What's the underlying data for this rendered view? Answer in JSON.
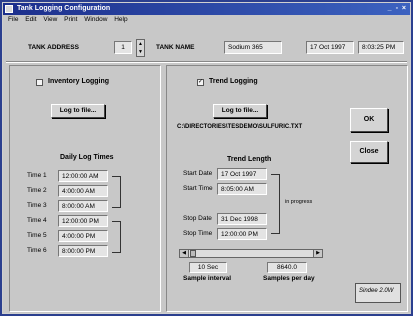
{
  "window": {
    "title": "Tank Logging Configuration",
    "controls": "_ ▫ ×"
  },
  "menu": [
    "File",
    "Edit",
    "View",
    "Print",
    "Window",
    "Help"
  ],
  "toolbar": {
    "tank_address_label": "TANK ADDRESS",
    "tank_address_value": "1",
    "tank_name_label": "TANK NAME",
    "tank_name_value": "Sodium 365",
    "date": "17 Oct 1997",
    "time": "8:03:25 PM"
  },
  "inventory": {
    "checkbox_label": "Inventory Logging",
    "checked": false,
    "log_button": "Log to file...",
    "daily_header": "Daily Log Times",
    "times": [
      {
        "label": "Time 1",
        "value": "12:00:00 AM"
      },
      {
        "label": "Time 2",
        "value": "4:00:00 AM"
      },
      {
        "label": "Time 3",
        "value": "8:00:00 AM"
      },
      {
        "label": "Time 4",
        "value": "12:00:00 PM"
      },
      {
        "label": "Time 5",
        "value": "4:00:00 PM"
      },
      {
        "label": "Time 6",
        "value": "8:00:00 PM"
      }
    ]
  },
  "trend": {
    "checkbox_label": "Trend Logging",
    "checked": true,
    "log_button": "Log to file...",
    "file_path": "C:\\DIRECTORIES\\TESDEMO\\SULFURIC.TXT",
    "length_header": "Trend Length",
    "start_date_label": "Start Date",
    "start_date": "17 Oct 1997",
    "start_time_label": "Start Time",
    "start_time": "8:05:00 AM",
    "stop_date_label": "Stop Date",
    "stop_date": "31 Dec 1998",
    "stop_time_label": "Stop Time",
    "stop_time": "12:00:00 PM",
    "status": "in progress",
    "interval_value": "10 Sec",
    "interval_label": "Sample interval",
    "samples_value": "8640.0",
    "samples_label": "Samples per day"
  },
  "buttons": {
    "ok": "OK",
    "close": "Close"
  },
  "logo": "Sindee 2.0W"
}
